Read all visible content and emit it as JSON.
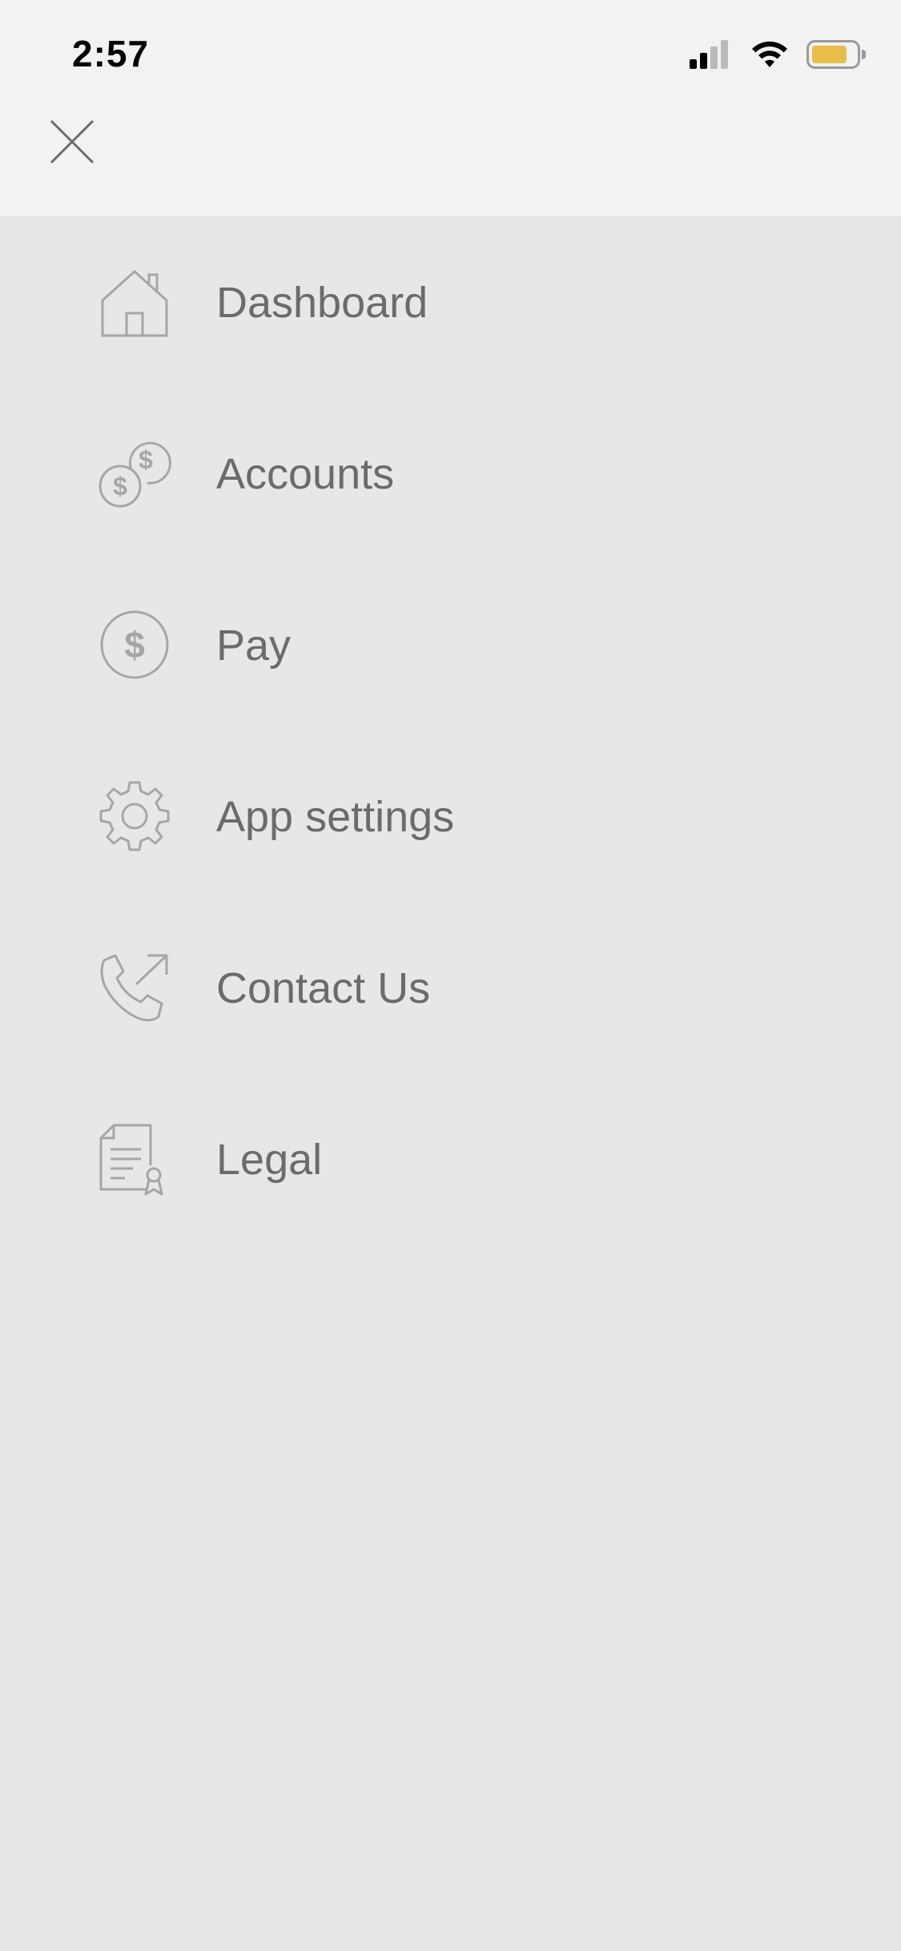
{
  "status_bar": {
    "time": "2:57",
    "battery_color": "#e6be49"
  },
  "header": {
    "close_icon": "close-icon"
  },
  "menu": {
    "items": [
      {
        "label": "Dashboard",
        "icon": "house-icon"
      },
      {
        "label": "Accounts",
        "icon": "coins-icon"
      },
      {
        "label": "Pay",
        "icon": "dollar-circle-icon"
      },
      {
        "label": "App settings",
        "icon": "gear-icon"
      },
      {
        "label": "Contact Us",
        "icon": "phone-outgoing-icon"
      },
      {
        "label": "Legal",
        "icon": "certificate-document-icon"
      }
    ]
  },
  "colors": {
    "background": "#e7e7e7",
    "header_background": "#f2f2f2",
    "text": "#6b6b6b",
    "icon": "#a6a6a6"
  }
}
